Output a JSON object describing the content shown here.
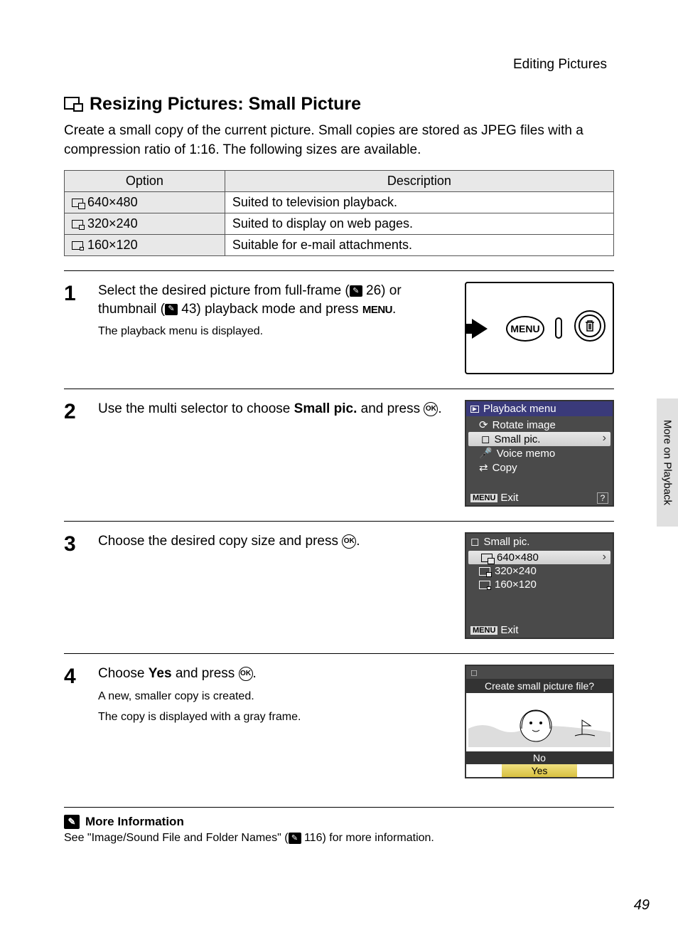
{
  "breadcrumb": "Editing Pictures",
  "section_title": "Resizing Pictures: Small Picture",
  "intro": "Create a small copy of the current picture. Small copies are stored as JPEG files with a compression ratio of 1:16. The following sizes are available.",
  "table": {
    "headers": [
      "Option",
      "Description"
    ],
    "rows": [
      {
        "option": "640×480",
        "desc": "Suited to television playback."
      },
      {
        "option": "320×240",
        "desc": "Suited to display on web pages."
      },
      {
        "option": "160×120",
        "desc": "Suitable for e-mail attachments."
      }
    ]
  },
  "steps": [
    {
      "num": "1",
      "text_pre": "Select the desired picture from full-frame (",
      "ref1": "26",
      "text_mid": ") or thumbnail (",
      "ref2": "43",
      "text_end": ") playback mode and press ",
      "menu_label": "MENU",
      "sub": "The playback menu is displayed."
    },
    {
      "num": "2",
      "text_pre": "Use the multi selector to choose ",
      "bold": "Small pic.",
      "text_end": " and press ",
      "ok": true,
      "menu": {
        "title": "Playback menu",
        "items": [
          "Rotate image",
          "Small pic.",
          "Voice memo",
          "Copy"
        ],
        "selected_index": 1,
        "exit": "Exit"
      }
    },
    {
      "num": "3",
      "text": "Choose the desired copy size and press ",
      "ok": true,
      "menu": {
        "title": "Small pic.",
        "items": [
          "640×480",
          "320×240",
          "160×120"
        ],
        "selected_index": 0,
        "exit": "Exit"
      }
    },
    {
      "num": "4",
      "text_pre": "Choose ",
      "bold": "Yes",
      "text_end": " and press ",
      "ok": true,
      "sub1": "A new, smaller copy is created.",
      "sub2": "The copy is displayed with a gray frame.",
      "dialog": {
        "prompt": "Create small picture file?",
        "no": "No",
        "yes": "Yes"
      }
    }
  ],
  "side_tab": "More on Playback",
  "more_info": {
    "title": "More Information",
    "body_pre": "See \"Image/Sound File and Folder Names\" (",
    "ref": "116",
    "body_end": ") for more information."
  },
  "page_number": "49",
  "menu_tag": "MENU",
  "camera_menu_label": "MENU"
}
